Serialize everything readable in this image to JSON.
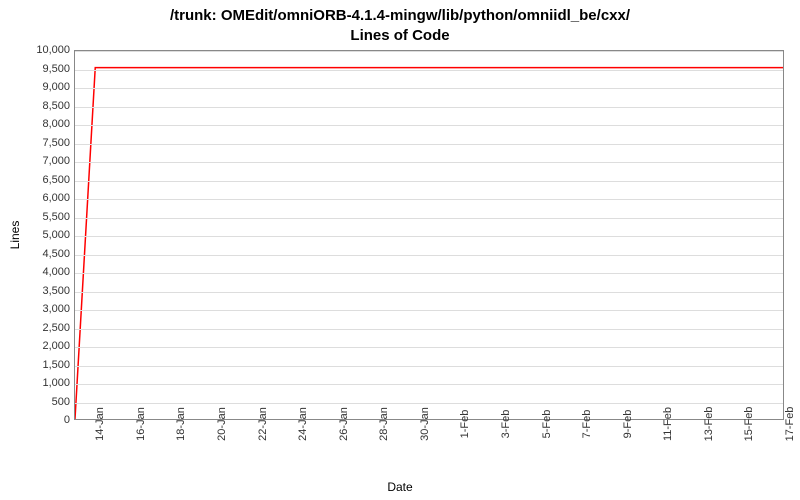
{
  "title_prefix": "/trunk: ",
  "title_path": "OMEdit/omniORB-4.1.4-mingw/lib/python/omniidl_be/cxx/",
  "subtitle": "Lines of Code",
  "ylabel": "Lines",
  "xlabel": "Date",
  "chart_data": {
    "type": "line",
    "title": "/trunk: OMEdit/omniORB-4.1.4-mingw/lib/python/omniidl_be/cxx/ Lines of Code",
    "xlabel": "Date",
    "ylabel": "Lines",
    "ylim": [
      0,
      10000
    ],
    "y_ticks": [
      0,
      500,
      1000,
      1500,
      2000,
      2500,
      3000,
      3500,
      4000,
      4500,
      5000,
      5500,
      6000,
      6500,
      7000,
      7500,
      8000,
      8500,
      9000,
      9500,
      10000
    ],
    "y_tick_labels": [
      "0",
      "500",
      "1,000",
      "1,500",
      "2,000",
      "2,500",
      "3,000",
      "3,500",
      "4,000",
      "4,500",
      "5,000",
      "5,500",
      "6,000",
      "6,500",
      "7,000",
      "7,500",
      "8,000",
      "8,500",
      "9,000",
      "9,500",
      "10,000"
    ],
    "x_categories": [
      "14-Jan",
      "16-Jan",
      "18-Jan",
      "20-Jan",
      "22-Jan",
      "24-Jan",
      "26-Jan",
      "28-Jan",
      "30-Jan",
      "1-Feb",
      "3-Feb",
      "5-Feb",
      "7-Feb",
      "9-Feb",
      "11-Feb",
      "13-Feb",
      "15-Feb",
      "17-Feb"
    ],
    "series": [
      {
        "name": "Lines of Code",
        "color": "#ff0000",
        "x": [
          "13-Jan",
          "14-Jan",
          "17-Feb"
        ],
        "values": [
          0,
          9550,
          9550
        ]
      }
    ]
  }
}
